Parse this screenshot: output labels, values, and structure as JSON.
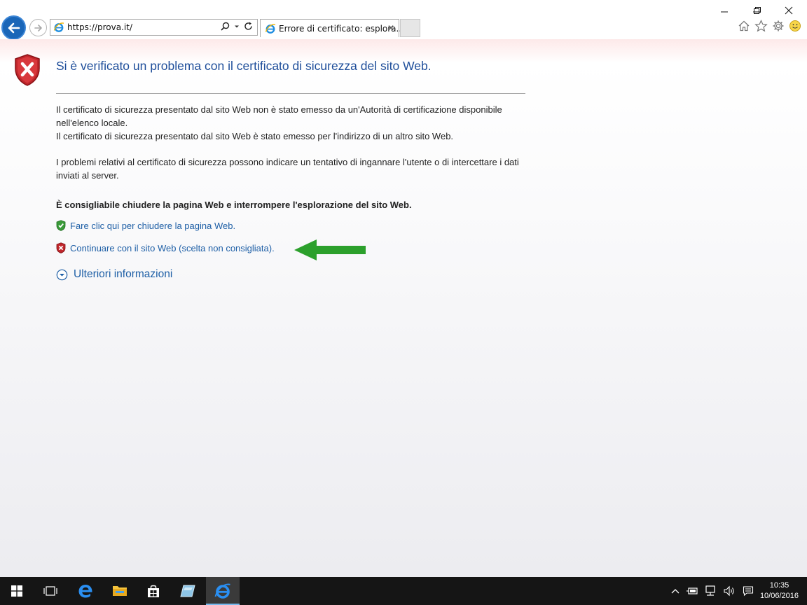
{
  "window": {
    "minimize_label": "–",
    "restore_label": "❐",
    "close_label": "✕"
  },
  "toolbar": {
    "address_url": "https://prova.it/",
    "tab_title": "Errore di certificato: esplora...",
    "tab_close": "✕"
  },
  "page": {
    "heading": "Si è verificato un problema con il certificato di sicurezza del sito Web.",
    "paragraph_1_line_1": "Il certificato di sicurezza presentato dal sito Web non è stato emesso da un'Autorità di certificazione disponibile nell'elenco locale.",
    "paragraph_1_line_2": "Il certificato di sicurezza presentato dal sito Web è stato emesso per l'indirizzo di un altro sito Web.",
    "paragraph_2": "I problemi relativi al certificato di sicurezza possono indicare un tentativo di ingannare l'utente o di intercettare i dati inviati al server.",
    "recommendation": "È consigliabile chiudere la pagina Web e interrompere l'esplorazione del sito Web.",
    "close_link": "Fare clic qui per chiudere la pagina Web.",
    "continue_link": "Continuare con il sito Web (scelta non consigliata).",
    "more_info": "Ulteriori informazioni"
  },
  "colors": {
    "heading": "#1f4e9a",
    "link": "#1e5fa6",
    "arrow": "#2ca02c",
    "shield_red": "#c0262b"
  },
  "taskbar": {
    "time": "10:35",
    "date": "10/06/2016"
  }
}
